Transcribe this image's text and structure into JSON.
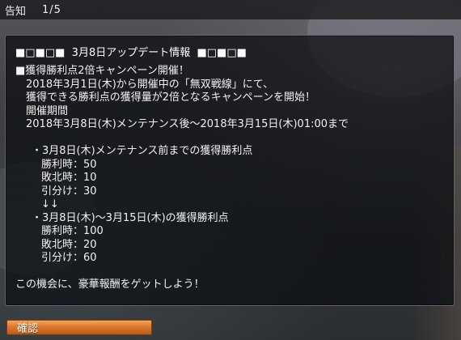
{
  "window": {
    "title": "告知",
    "pager": "1/5"
  },
  "notice": {
    "heading": "■□■□■  3月8日アップデート情報  ■□■□■",
    "lines": [
      "■獲得勝利点2倍キャンペーン開催！",
      "2018年3月1日(木)から開催中の「無双戦線」にて、",
      "獲得できる勝利点の獲得量が2倍となるキャンペーンを開始！",
      "開催期間",
      "2018年3月8日(木)メンテナンス後～2018年3月15日(木)01:00まで",
      "",
      "・3月8日(木)メンテナンス前までの獲得勝利点",
      "勝利時：50",
      "敗北時：10",
      "引分け：30",
      "↓↓",
      "・3月8日(木)～3月15日(木)の獲得勝利点",
      "勝利時：100",
      "敗北時：20",
      "引分け：60",
      "",
      "この機会に、豪華報酬をゲットしよう！"
    ]
  },
  "buttons": {
    "confirm": "確認"
  },
  "colors": {
    "confirm_button": "#d9762a",
    "panel_border": "#a0a0aa",
    "text": "#f2f2f2"
  }
}
